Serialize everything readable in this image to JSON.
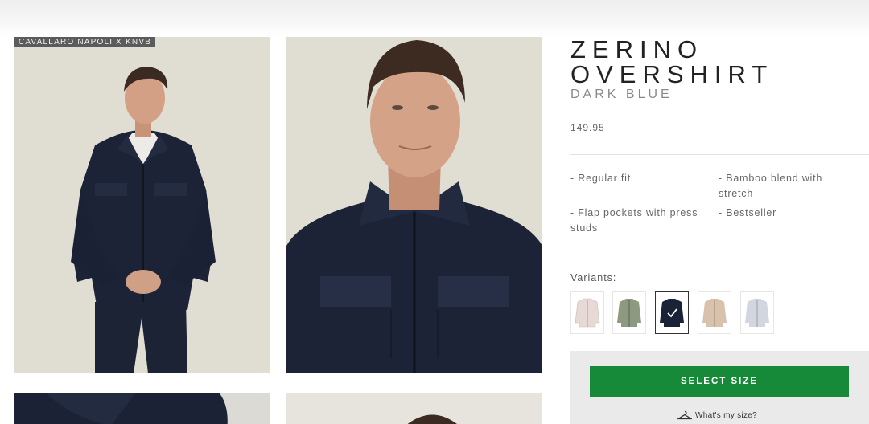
{
  "product": {
    "badge": "CAVALLARO NAPOLI X KNVB",
    "title": "ZERINO OVERSHIRT",
    "color_name": "DARK BLUE",
    "price": "149.95",
    "features": [
      "- Regular fit",
      "- Bamboo blend with stretch",
      "- Flap pockets with press studs",
      "- Bestseller"
    ]
  },
  "variants": {
    "label": "Variants:",
    "items": [
      {
        "name": "light-pink",
        "color": "#e7d9d6",
        "selected": false
      },
      {
        "name": "sage-green",
        "color": "#8e9a80",
        "selected": false
      },
      {
        "name": "dark-blue",
        "color": "#1a2238",
        "selected": true
      },
      {
        "name": "beige",
        "color": "#d9c2ad",
        "selected": false
      },
      {
        "name": "light-grey",
        "color": "#d2d6df",
        "selected": false
      }
    ]
  },
  "size": {
    "button_label": "SELECT SIZE",
    "help_link": "What's my size?"
  },
  "colors": {
    "accent_green": "#178a3a",
    "garment_navy": "#1b2236",
    "photo_bg": "#e0ddd3"
  }
}
